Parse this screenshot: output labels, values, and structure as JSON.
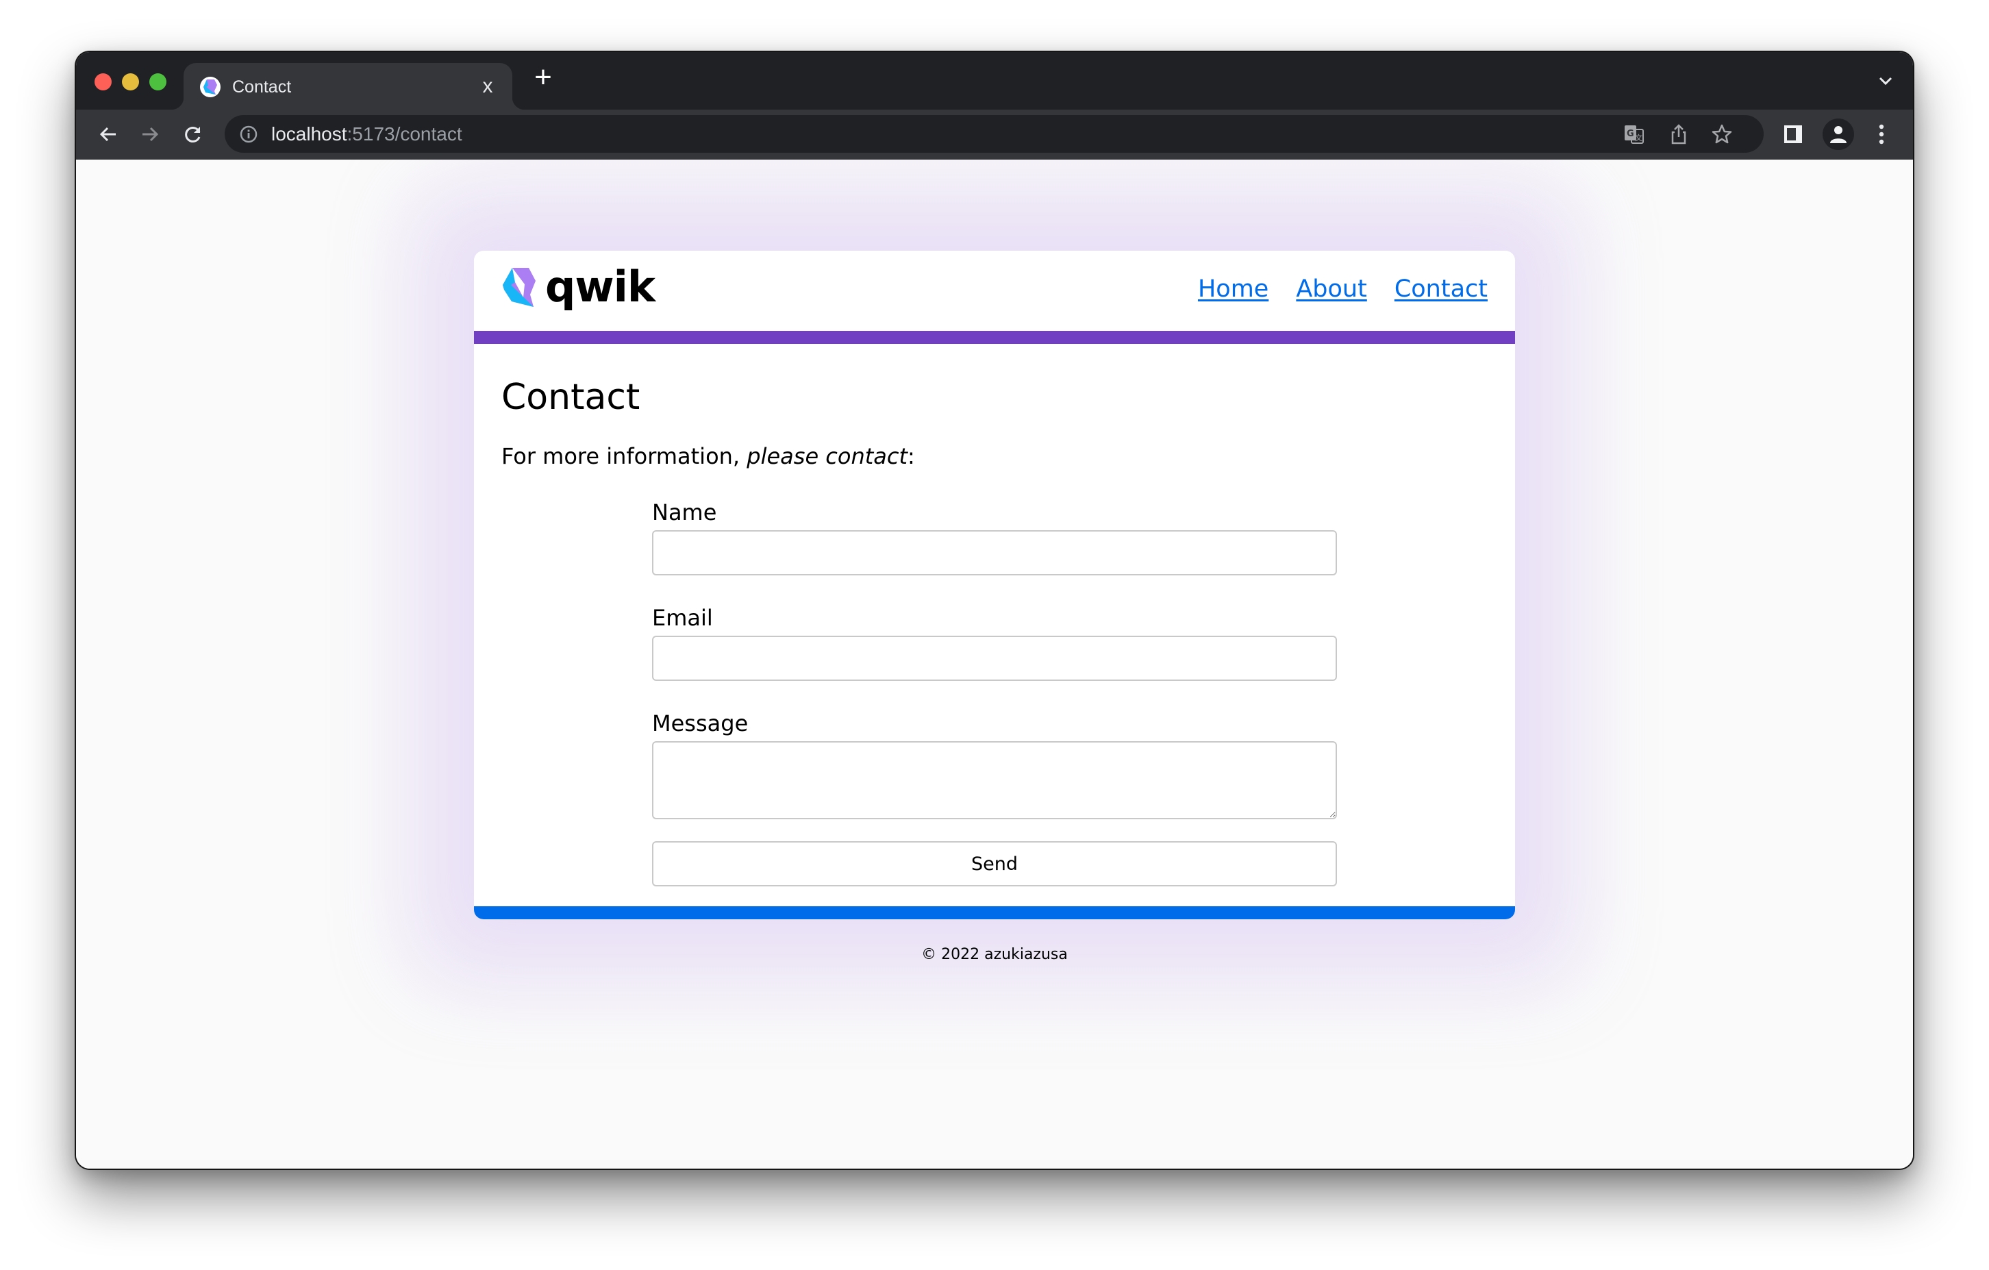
{
  "browser": {
    "tab": {
      "title": "Contact",
      "favicon": "qwik-logo-icon"
    },
    "new_tab_symbol": "+",
    "close_symbol": "x",
    "url": {
      "host": "localhost",
      "rest": ":5173/contact"
    },
    "toolbar_icons": [
      "back-icon",
      "forward-icon",
      "reload-icon",
      "info-icon",
      "translate-icon",
      "share-icon",
      "bookmark-star-icon",
      "side-panel-icon",
      "profile-icon",
      "kebab-menu-icon"
    ]
  },
  "site": {
    "logo_text": "qwik",
    "nav": [
      {
        "label": "Home"
      },
      {
        "label": "About"
      },
      {
        "label": "Contact"
      }
    ],
    "colors": {
      "purple_bar": "#713fc2",
      "blue_bar": "#006ce9",
      "link": "#006ce9"
    }
  },
  "page": {
    "title": "Contact",
    "intro_plain": "For more information, ",
    "intro_italic": "please contact",
    "intro_end": ":",
    "form": {
      "name_label": "Name",
      "name_value": "",
      "email_label": "Email",
      "email_value": "",
      "message_label": "Message",
      "message_value": "",
      "submit_label": "Send"
    }
  },
  "footer": {
    "text": "© 2022 azukiazusa"
  }
}
